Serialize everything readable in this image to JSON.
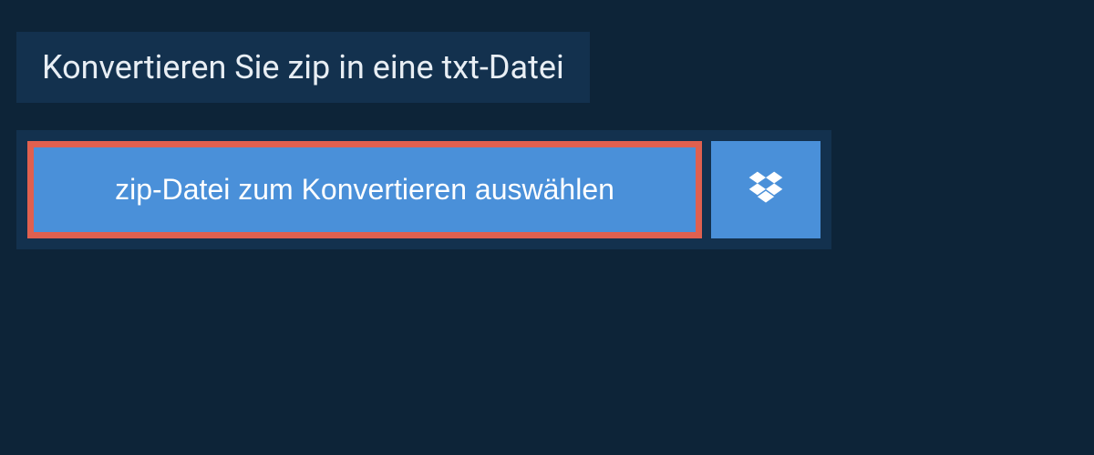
{
  "header": {
    "title": "Konvertieren Sie zip in eine txt-Datei"
  },
  "upload": {
    "select_label": "zip-Datei zum Konvertieren auswählen",
    "dropbox_icon": "dropbox-icon"
  },
  "colors": {
    "page_bg": "#0d2438",
    "panel_bg": "#13314e",
    "button_bg": "#4a90d9",
    "highlight_border": "#e0604f",
    "text_light": "#e8eef4"
  }
}
